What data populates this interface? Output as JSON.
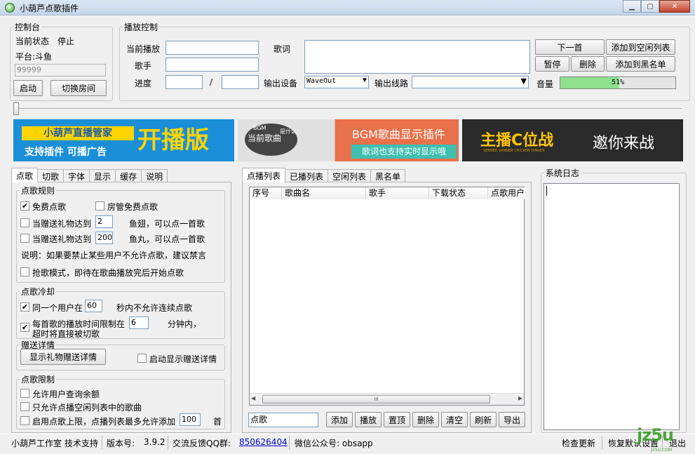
{
  "window": {
    "title": "小葫芦点歌插件",
    "min": "▁",
    "max": "▢",
    "close": "✕"
  },
  "console": {
    "legend": "控制台",
    "status_label": "当前状态",
    "status_value": "停止",
    "platform": "平台:斗鱼",
    "room": "99999",
    "start": "启动",
    "switch_room": "切换房间"
  },
  "playback": {
    "legend": "播放控制",
    "current": "当前播放",
    "lyrics": "歌词",
    "singer": "歌手",
    "progress": "进度",
    "slash": "/",
    "output_device": "输出设备",
    "device_value": "WaveOut",
    "output_line": "输出线路",
    "line_value": "",
    "volume": "音量",
    "volume_pct": "51%",
    "volume_fraction": 0.51,
    "next": "下一首",
    "add_idle": "添加到空闲列表",
    "pause": "暂停",
    "delete": "删除",
    "add_black": "添加到黑名单"
  },
  "banners": {
    "b1_left1": "小葫芦直播管家",
    "b1_left2": "支持插件 可播广告",
    "b1_right": "开播版",
    "b2_tag": "BGM",
    "b2_left": "当前歌曲",
    "b2_what": "是什么？",
    "b2_title": "BGM歌曲显示插件",
    "b2_sub": "歌词也支持实时显示哦",
    "b3_left": "主播C位战",
    "b3_sub": "WINNER WINNER CHICKEN DINNER",
    "b3_right": "邀你来战"
  },
  "left_tabs": [
    "点歌",
    "切歌",
    "字体",
    "显示",
    "缓存",
    "说明"
  ],
  "rules": {
    "legend": "点歌规则",
    "free": "免费点歌",
    "admin_free": "房管免费点歌",
    "gift1_pre": "当赠送礼物达到",
    "gift1_val": "2",
    "gift1_post": "鱼翅，可以点一首歌",
    "gift2_pre": "当赠送礼物达到",
    "gift2_val": "200",
    "gift2_post": "鱼丸，可以点一首歌",
    "note": "说明：如果要禁止某些用户不允许点歌，建议禁言",
    "grab": "抢歌模式，即待在歌曲播放完后开始点歌"
  },
  "cooldown": {
    "legend": "点歌冷却",
    "same_user_pre": "同一个用户在",
    "same_user_val": "60",
    "same_user_post": "秒内不允许连续点歌",
    "limit_pre": "每首歌的播放时间限制在",
    "limit_val": "6",
    "limit_post": "分钟内，",
    "limit_line2": "超时将直接被切歌"
  },
  "gift": {
    "legend": "赠送详情",
    "show_btn": "显示礼物赠送详情",
    "auto_show": "启动显示赠送详情"
  },
  "restrict": {
    "legend": "点歌限制",
    "query_balance": "允许用户查询余额",
    "only_idle": "只允许点播空闲列表中的歌曲",
    "limit_pre": "启用点歌上限，点播列表最多允许添加",
    "limit_val": "100",
    "limit_post": "首"
  },
  "mid_tabs": [
    "点播列表",
    "已播列表",
    "空闲列表",
    "黑名单"
  ],
  "table": {
    "cols": [
      "序号",
      "歌曲名",
      "歌手",
      "下载状态",
      "点歌用户"
    ],
    "scroll_mark": "III"
  },
  "bottom": {
    "input": "点歌",
    "add": "添加",
    "play": "播放",
    "top": "置顶",
    "delete": "删除",
    "clear": "清空",
    "refresh": "刷新",
    "export": "导出"
  },
  "log": {
    "legend": "系统日志"
  },
  "status": {
    "studio": "小葫芦工作室 技术支持",
    "version_label": "版本号:",
    "version": "3.9.2",
    "qq_label": "交流反馈QQ群:",
    "qq": "850626404",
    "wechat": "微信公众号: obsapp",
    "check_update": "检查更新",
    "restore": "恢复默认设置",
    "exit": "退出"
  },
  "watermark": {
    "text": "jz5u",
    "sub": "JZ5U.COM"
  },
  "colors": {
    "volume": "#8fe08f",
    "link": "#0000cc",
    "banner1": "#1a8fd8",
    "banner1_yellow": "#ffd400",
    "banner2": "#e8704a",
    "banner3": "#2a2a2a"
  }
}
